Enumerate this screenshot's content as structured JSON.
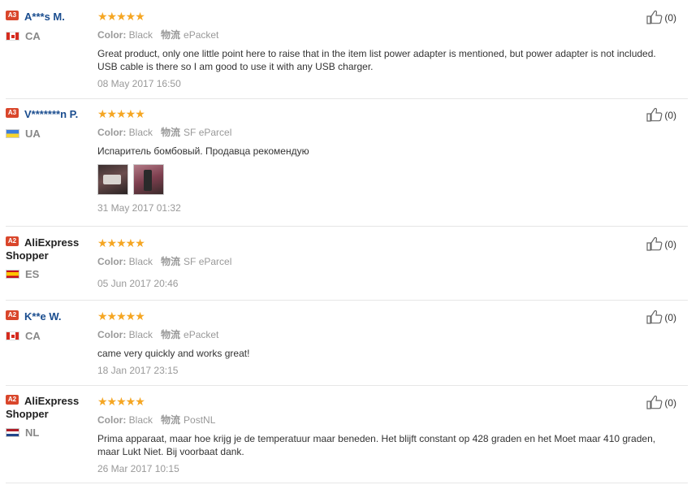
{
  "meta_labels": {
    "color": "Color:",
    "shipping": "物流"
  },
  "reviews": [
    {
      "level": "A3",
      "name": "A***s M.",
      "country": "CA",
      "flag": "ca",
      "stars": "★★★★★",
      "color": "Black",
      "shipping": "ePacket",
      "text": "Great product, only one little point here to raise that in the item list power adapter is mentioned, but power adapter is not included. USB cable is there so I am good to use it with any USB charger.",
      "date": "08 May 2017 16:50",
      "likes": "(0)"
    },
    {
      "level": "A3",
      "name": "V*******n P.",
      "country": "UA",
      "flag": "ua",
      "stars": "★★★★★",
      "color": "Black",
      "shipping": "SF eParcel",
      "text": "Испаритель бомбовый. Продавца рекомендую",
      "date": "31 May 2017 01:32",
      "likes": "(0)"
    },
    {
      "level": "A2",
      "name": "AliExpress Shopper",
      "country": "ES",
      "flag": "es",
      "stars": "★★★★★",
      "color": "Black",
      "shipping": "SF eParcel",
      "text": "",
      "date": "05 Jun 2017 20:46",
      "likes": "(0)"
    },
    {
      "level": "A2",
      "name": "K**e W.",
      "country": "CA",
      "flag": "ca",
      "stars": "★★★★★",
      "color": "Black",
      "shipping": "ePacket",
      "text": "came very quickly and works great!",
      "date": "18 Jan 2017 23:15",
      "likes": "(0)"
    },
    {
      "level": "A2",
      "name": "AliExpress Shopper",
      "country": "NL",
      "flag": "nl",
      "stars": "★★★★★",
      "color": "Black",
      "shipping": "PostNL",
      "text": "Prima apparaat, maar hoe krijg je de temperatuur maar beneden. Het blijft constant op 428 graden en het Moet maar 410 graden, maar Lukt Niet. Bij voorbaat dank.",
      "date": "26 Mar 2017 10:15",
      "likes": "(0)"
    }
  ],
  "icons": {
    "like": "thumbs-up-icon",
    "level_badge": "level-badge",
    "flag": "country-flag-icon"
  },
  "colors": {
    "star": "#f5a623",
    "level_badge": "#d9462b",
    "username": "#1a4d8f"
  }
}
